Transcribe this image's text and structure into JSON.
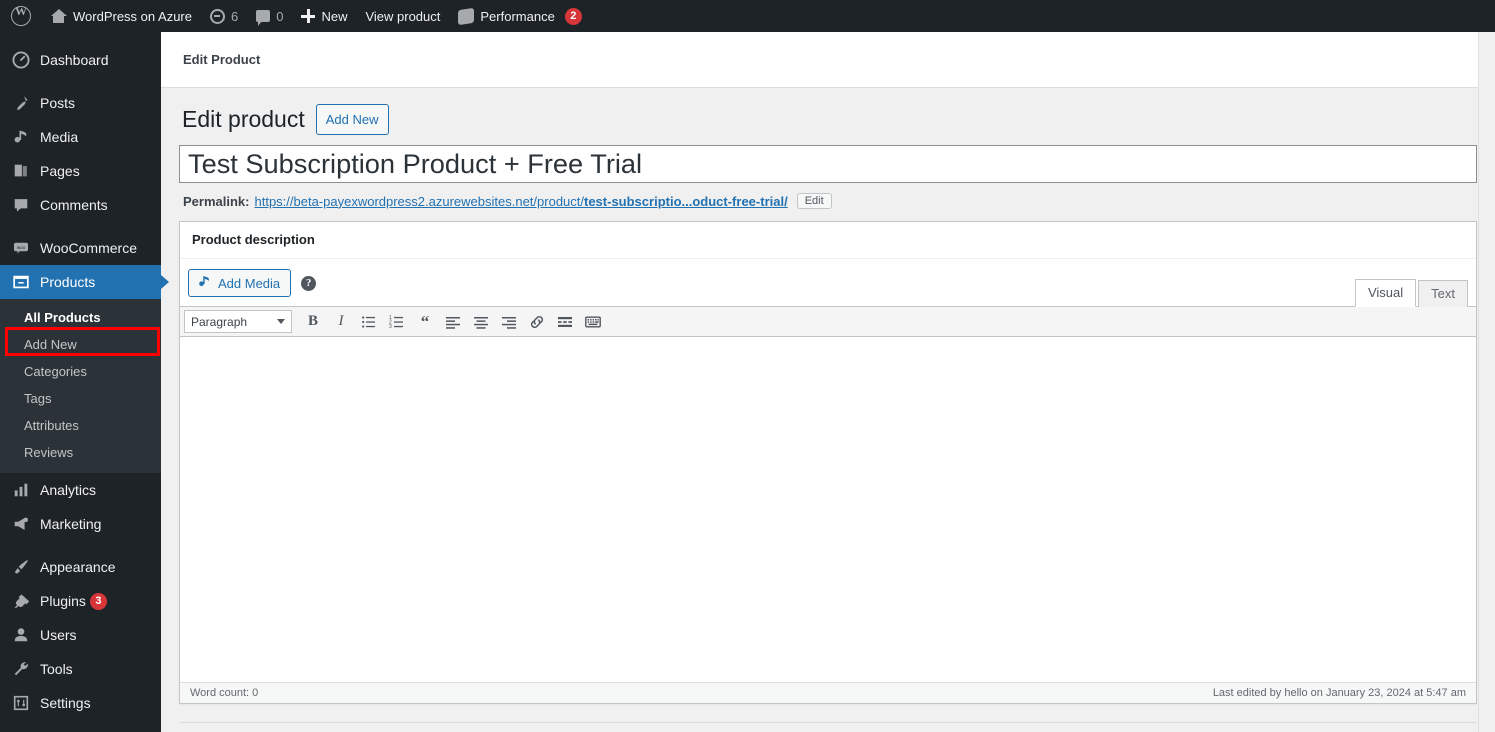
{
  "adminbar": {
    "logo_icon": "wordpress-logo-icon",
    "site_name": "WordPress on Azure",
    "site_icon": "home-icon",
    "updates_icon": "updates-icon",
    "updates_count": "6",
    "comments_icon": "comment-bubble-icon",
    "comments_count": "0",
    "new_icon": "plus-icon",
    "new_label": "New",
    "view_product_label": "View product",
    "performance_icon": "performance-icon",
    "performance_label": "Performance",
    "performance_badge": "2"
  },
  "sidebar": {
    "items": [
      {
        "label": "Dashboard",
        "icon": "dashboard-icon"
      },
      {
        "label": "Posts",
        "icon": "pin-icon"
      },
      {
        "label": "Media",
        "icon": "media-icon"
      },
      {
        "label": "Pages",
        "icon": "pages-icon"
      },
      {
        "label": "Comments",
        "icon": "comment-bubble-icon"
      },
      {
        "label": "WooCommerce",
        "icon": "woocommerce-icon"
      },
      {
        "label": "Products",
        "icon": "products-icon"
      },
      {
        "label": "Analytics",
        "icon": "analytics-icon"
      },
      {
        "label": "Marketing",
        "icon": "megaphone-icon"
      },
      {
        "label": "Appearance",
        "icon": "paintbrush-icon"
      },
      {
        "label": "Plugins",
        "icon": "plug-icon",
        "badge": "3"
      },
      {
        "label": "Users",
        "icon": "user-icon"
      },
      {
        "label": "Tools",
        "icon": "wrench-icon"
      },
      {
        "label": "Settings",
        "icon": "settings-icon"
      }
    ],
    "products_submenu": [
      {
        "label": "All Products"
      },
      {
        "label": "Add New"
      },
      {
        "label": "Categories"
      },
      {
        "label": "Tags"
      },
      {
        "label": "Attributes"
      },
      {
        "label": "Reviews"
      }
    ],
    "highlight": {
      "target_label": "Add New",
      "color": "#ff0000"
    }
  },
  "content": {
    "breadcrumb": "Edit Product",
    "page_title": "Edit product",
    "add_new_button": "Add New",
    "title_value": "Test Subscription Product + Free Trial",
    "title_placeholder": "Product name",
    "permalink": {
      "label": "Permalink:",
      "url_prefix": "https://beta-payexwordpress2.azurewebsites.net/product/",
      "url_slug": "test-subscriptio...oduct-free-trial/",
      "edit_button": "Edit"
    },
    "description_box": {
      "title": "Product description",
      "add_media_label": "Add Media",
      "add_media_icon": "media-icon",
      "help_icon": "help-icon",
      "help_glyph": "?",
      "tabs": [
        {
          "label": "Visual",
          "active": true
        },
        {
          "label": "Text",
          "active": false
        }
      ],
      "toolbar": {
        "format_select": "Paragraph",
        "buttons": [
          {
            "name": "bold-icon",
            "glyph": "B"
          },
          {
            "name": "italic-icon",
            "glyph": "I"
          },
          {
            "name": "bulleted-list-icon",
            "glyph": ""
          },
          {
            "name": "numbered-list-icon",
            "glyph": ""
          },
          {
            "name": "blockquote-icon",
            "glyph": "“"
          },
          {
            "name": "align-left-icon",
            "glyph": ""
          },
          {
            "name": "align-center-icon",
            "glyph": ""
          },
          {
            "name": "align-right-icon",
            "glyph": ""
          },
          {
            "name": "insert-link-icon",
            "glyph": ""
          },
          {
            "name": "insert-read-more-icon",
            "glyph": ""
          },
          {
            "name": "keyboard-shortcuts-icon",
            "glyph": ""
          }
        ]
      },
      "body_content": "",
      "word_count": "Word count: 0",
      "last_edited": "Last edited by hello on January 23, 2024 at 5:47 am"
    }
  },
  "colors": {
    "admin_dark": "#1d2327",
    "submenu_dark": "#2c3338",
    "accent_blue": "#2271b1",
    "badge_red": "#d63638",
    "highlight_red": "#ff0000",
    "page_bg": "#f0f0f1"
  }
}
